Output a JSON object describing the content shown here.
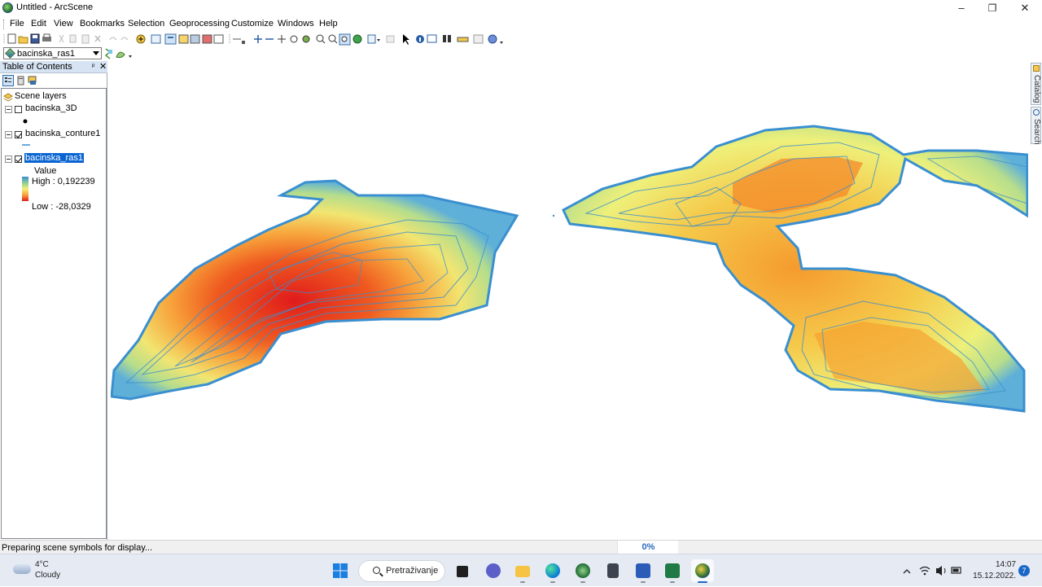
{
  "window": {
    "title": "Untitled - ArcScene",
    "minimize": "–",
    "maximize": "❐",
    "close": "✕"
  },
  "menu": [
    "File",
    "Edit",
    "View",
    "Bookmarks",
    "Selection",
    "Geoprocessing",
    "Customize",
    "Windows",
    "Help"
  ],
  "layer_selector": {
    "value": "bacinska_ras1"
  },
  "toc": {
    "title": "Table of Contents",
    "pin": "ᵖ",
    "close": "✕",
    "root": "Scene layers",
    "layers": [
      {
        "name": "bacinska_3D",
        "checked": false
      },
      {
        "name": "bacinska_conture1",
        "checked": true
      },
      {
        "name": "bacinska_ras1",
        "checked": true,
        "selected": true
      }
    ],
    "legend": {
      "field": "Value",
      "high": "High : 0,192239",
      "low": "Low : -28,0329"
    }
  },
  "side_tabs": [
    "Catalog",
    "Search"
  ],
  "status": {
    "message": "Preparing scene symbols for display...",
    "progress_label": "0%",
    "progress_value": 0
  },
  "taskbar": {
    "weather": {
      "temp": "4°C",
      "desc": "Cloudy"
    },
    "search_label": "Pretraživanje",
    "clock_time": "14:07",
    "clock_date": "15.12.2022.",
    "notifications": "7"
  },
  "colors": {
    "toc_header": "#d6e3f2",
    "selection": "#0a64d2",
    "contour": "#3a8fd0",
    "raster_high": "#e01b1b",
    "raster_mid": "#f7a23a",
    "raster_low": "#f7ef7b"
  }
}
